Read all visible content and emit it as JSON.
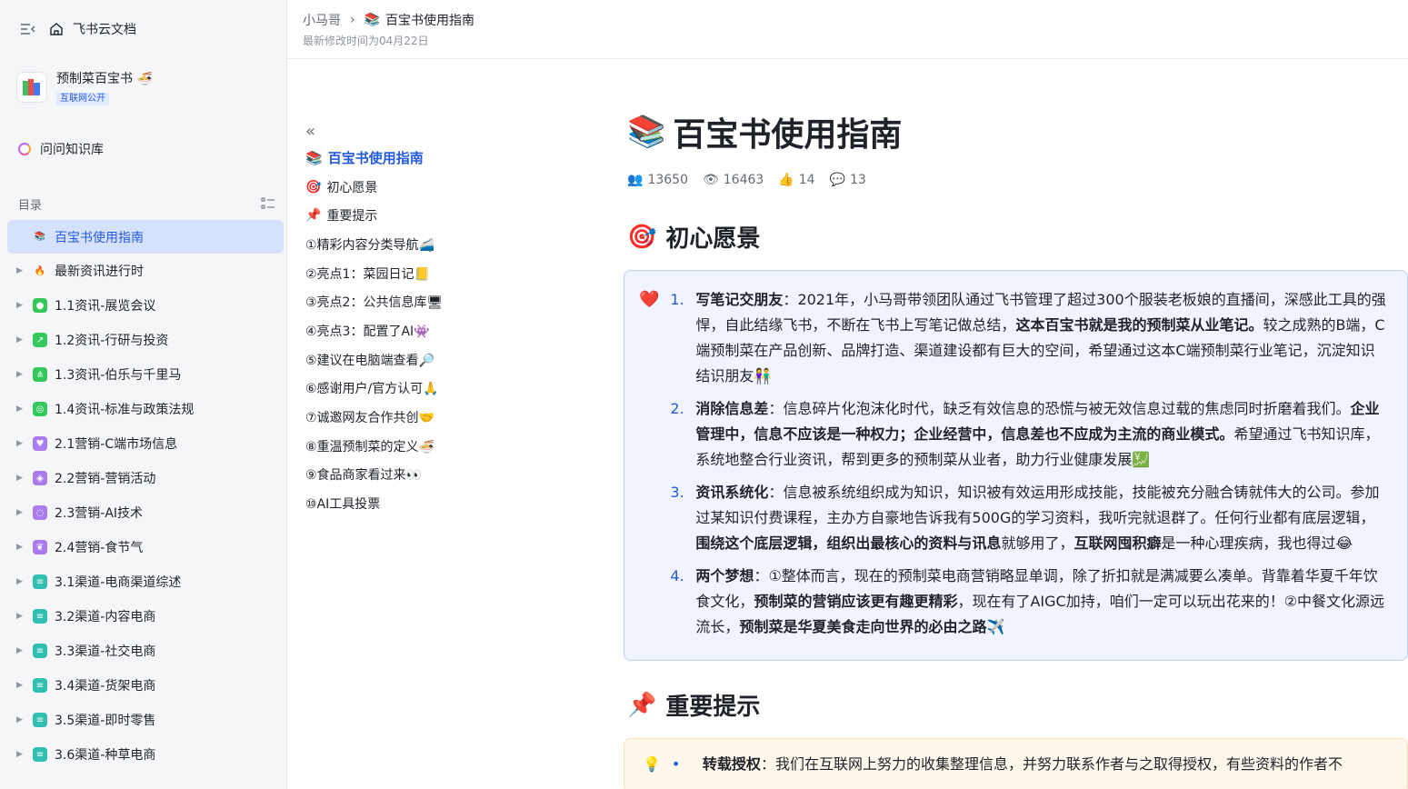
{
  "app": {
    "name": "飞书云文档"
  },
  "space": {
    "name": "预制菜百宝书",
    "badge": "互联网公开"
  },
  "ask": {
    "label": "问问知识库"
  },
  "toc": {
    "label": "目录",
    "items": [
      {
        "label": "百宝书使用指南",
        "active": true
      },
      {
        "label": "最新资讯进行时"
      },
      {
        "label": "1.1资讯-展览会议"
      },
      {
        "label": "1.2资讯-行研与投资"
      },
      {
        "label": "1.3资讯-伯乐与千里马"
      },
      {
        "label": "1.4资讯-标准与政策法规"
      },
      {
        "label": "2.1营销-C端市场信息"
      },
      {
        "label": "2.2营销-营销活动"
      },
      {
        "label": "2.3营销-AI技术"
      },
      {
        "label": "2.4营销-食节气"
      },
      {
        "label": "3.1渠道-电商渠道综述"
      },
      {
        "label": "3.2渠道-内容电商"
      },
      {
        "label": "3.3渠道-社交电商"
      },
      {
        "label": "3.4渠道-货架电商"
      },
      {
        "label": "3.5渠道-即时零售"
      },
      {
        "label": "3.6渠道-种草电商"
      }
    ]
  },
  "header": {
    "crumb_parent": "小马哥",
    "crumb_current": "百宝书使用指南",
    "modified": "最新修改时间为04月22日"
  },
  "outline": {
    "items": [
      "百宝书使用指南",
      "初心愿景",
      "重要提示",
      "①精彩内容分类导航🚄",
      "②亮点1：菜园日记📒",
      "③亮点2：公共信息库🖥",
      "④亮点3：配置了AI👾",
      "⑤建议在电脑端查看🔎",
      "⑥感谢用户/官方认可🙏",
      "⑦诚邀网友合作共创🤝",
      "⑧重温预制菜的定义🍜",
      "⑨食品商家看过来👀",
      "⑩AI工具投票"
    ]
  },
  "doc": {
    "title": "百宝书使用指南",
    "stats": {
      "readers": "13650",
      "views": "16463",
      "likes": "14",
      "comments": "13"
    },
    "section1": "初心愿景",
    "list": [
      {
        "n": "1.",
        "b1": "写笔记交朋友",
        "t1": "：2021年，小马哥带领团队通过飞书管理了超过300个服装老板娘的直播间，深感此工具的强悍，自此结缘飞书，不断在飞书上写笔记做总结，",
        "b2": "这本百宝书就是我的预制菜从业笔记。",
        "t2": "较之成熟的B端，C端预制菜在产品创新、品牌打造、渠道建设都有巨大的空间，希望通过这本C端预制菜行业笔记，沉淀知识结识朋友👫"
      },
      {
        "n": "2.",
        "b1": "消除信息差",
        "t1": "：信息碎片化泡沫化时代，缺乏有效信息的恐慌与被无效信息过载的焦虑同时折磨着我们。",
        "b2": "企业管理中，信息不应该是一种权力；企业经营中，信息差也不应成为主流的商业模式。",
        "t2": "希望通过飞书知识库，系统地整合行业资讯，帮到更多的预制菜从业者，助力行业健康发展💹"
      },
      {
        "n": "3.",
        "b1": "资讯系统化",
        "t1": "：信息被系统组织成为知识，知识被有效运用形成技能，技能被充分融合铸就伟大的公司。参加过某知识付费课程，主办方自豪地告诉我有500G的学习资料，我听完就退群了。任何行业都有底层逻辑，",
        "b2": "围绕这个底层逻辑，组织出最核心的资料与讯息",
        "t2": "就够用了，",
        "b3": "互联网囤积癖",
        "t3": "是一种心理疾病，我也得过😂"
      },
      {
        "n": "4.",
        "b1": "两个梦想",
        "t1": "：①整体而言，现在的预制菜电商营销略显单调，除了折扣就是满减要么凑单。背靠着华夏千年饮食文化，",
        "b2": "预制菜的营销应该更有趣更精彩",
        "t2": "，现在有了AIGC加持，咱们一定可以玩出花来的！②中餐文化源远流长，",
        "b3": "预制菜是华夏美食走向世界的必由之路",
        "t3": "✈️"
      }
    ],
    "section2": "重要提示",
    "notice_b": "转载授权",
    "notice_t": "：我们在互联网上努力的收集整理信息，并努力联系作者与之取得授权，有些资料的作者不"
  }
}
